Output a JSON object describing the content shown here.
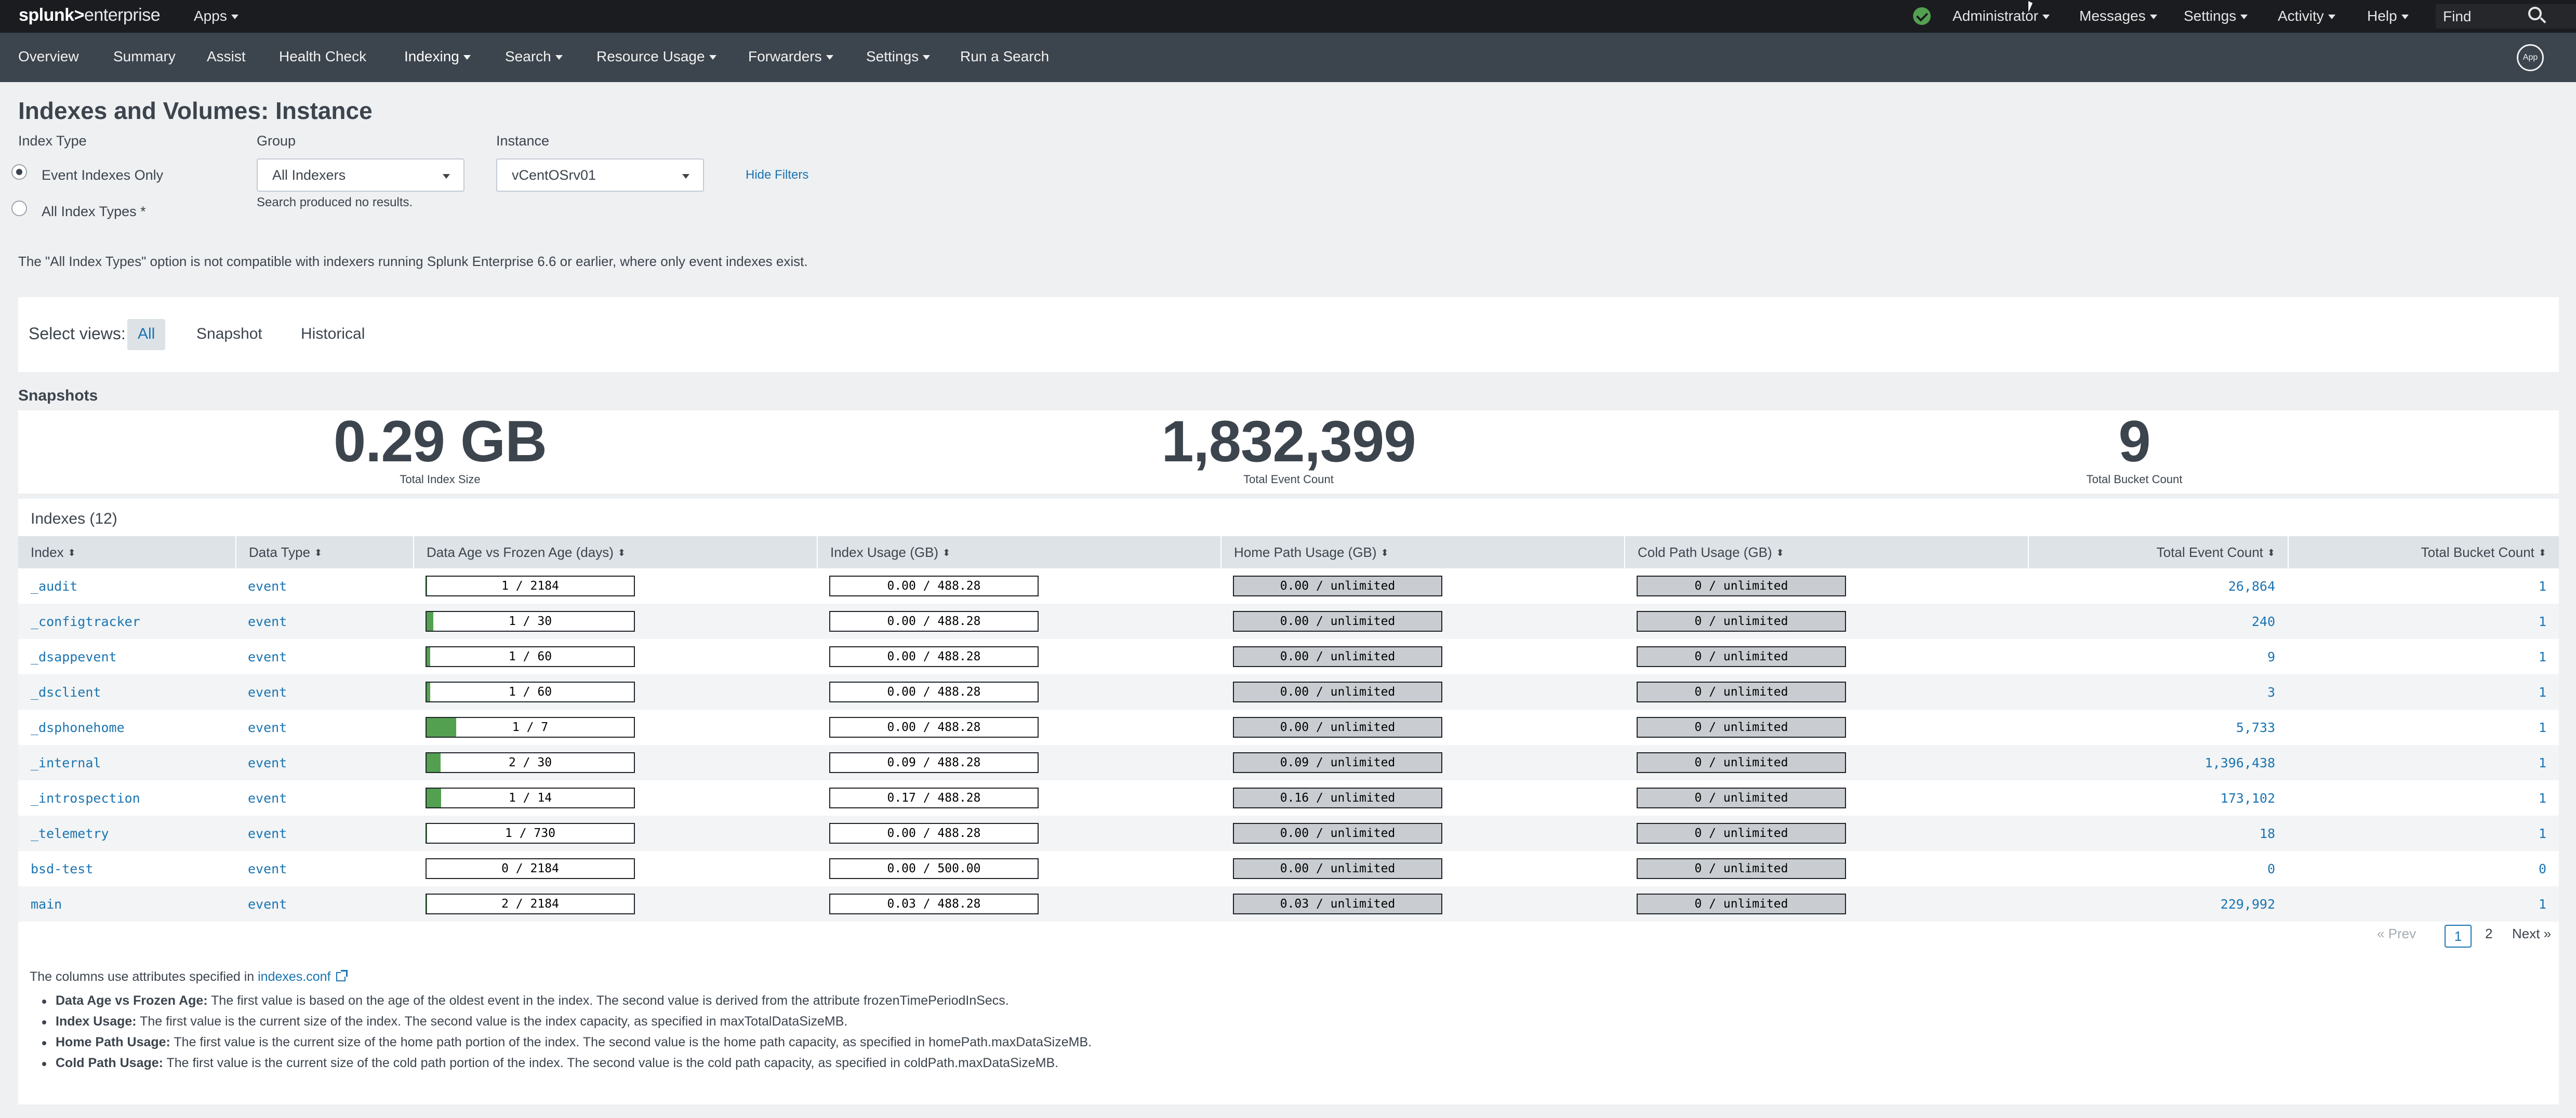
{
  "topbar": {
    "logo_bold": "splunk>",
    "logo_light": "enterprise",
    "apps": "Apps",
    "user": "Administrator",
    "messages": "Messages",
    "settings": "Settings",
    "activity": "Activity",
    "help": "Help",
    "find_placeholder": "Find",
    "status_color": "#53a051"
  },
  "nav": {
    "items": [
      "Overview",
      "Summary",
      "Assist",
      "Health Check",
      "Indexing",
      "Search",
      "Resource Usage",
      "Forwarders",
      "Settings",
      "Run a Search"
    ],
    "active": "Indexing",
    "app_badge": "App"
  },
  "page": {
    "title": "Indexes and Volumes: Instance"
  },
  "filters": {
    "index_type_label": "Index Type",
    "option_event": "Event Indexes Only",
    "option_all": "All Index Types *",
    "selected": "Event Indexes Only",
    "group_label": "Group",
    "group_value": "All Indexers",
    "group_message": "Search produced no results.",
    "instance_label": "Instance",
    "instance_value": "vCentOSrv01",
    "hide_filters": "Hide Filters",
    "note": "The \"All Index Types\" option is not compatible with indexers running Splunk Enterprise 6.6 or earlier, where only event indexes exist."
  },
  "views": {
    "label": "Select views:",
    "options": [
      "All",
      "Snapshot",
      "Historical"
    ],
    "active": "All"
  },
  "snapshots": {
    "title": "Snapshots",
    "total_index_size": "0.29 GB",
    "total_index_size_label": "Total Index Size",
    "total_event_count": "1,832,399",
    "total_event_count_label": "Total Event Count",
    "total_bucket_count": "9",
    "total_bucket_count_label": "Total Bucket Count"
  },
  "indexes": {
    "title": "Indexes (12)",
    "columns": [
      "Index",
      "Data Type",
      "Data Age vs Frozen Age (days)",
      "Index Usage (GB)",
      "Home Path Usage (GB)",
      "Cold Path Usage (GB)",
      "Total Event Count",
      "Total Bucket Count"
    ],
    "rows": [
      {
        "index": "_audit",
        "type": "event",
        "age": "1 / 2184",
        "age_pct": 0.05,
        "usage": "0.00 / 488.28",
        "usage_pct": 0,
        "home": "0.00 / unlimited",
        "cold": "0 / unlimited",
        "events": "26,864",
        "buckets": "1"
      },
      {
        "index": "_configtracker",
        "type": "event",
        "age": "1 / 30",
        "age_pct": 3.3,
        "usage": "0.00 / 488.28",
        "usage_pct": 0,
        "home": "0.00 / unlimited",
        "cold": "0 / unlimited",
        "events": "240",
        "buckets": "1"
      },
      {
        "index": "_dsappevent",
        "type": "event",
        "age": "1 / 60",
        "age_pct": 1.7,
        "usage": "0.00 / 488.28",
        "usage_pct": 0,
        "home": "0.00 / unlimited",
        "cold": "0 / unlimited",
        "events": "9",
        "buckets": "1"
      },
      {
        "index": "_dsclient",
        "type": "event",
        "age": "1 / 60",
        "age_pct": 1.7,
        "usage": "0.00 / 488.28",
        "usage_pct": 0,
        "home": "0.00 / unlimited",
        "cold": "0 / unlimited",
        "events": "3",
        "buckets": "1"
      },
      {
        "index": "_dsphonehome",
        "type": "event",
        "age": "1 / 7",
        "age_pct": 14.3,
        "usage": "0.00 / 488.28",
        "usage_pct": 0,
        "home": "0.00 / unlimited",
        "cold": "0 / unlimited",
        "events": "5,733",
        "buckets": "1"
      },
      {
        "index": "_internal",
        "type": "event",
        "age": "2 / 30",
        "age_pct": 6.7,
        "usage": "0.09 / 488.28",
        "usage_pct": 0,
        "home": "0.09 / unlimited",
        "cold": "0 / unlimited",
        "events": "1,396,438",
        "buckets": "1"
      },
      {
        "index": "_introspection",
        "type": "event",
        "age": "1 / 14",
        "age_pct": 7.1,
        "usage": "0.17 / 488.28",
        "usage_pct": 0,
        "home": "0.16 / unlimited",
        "cold": "0 / unlimited",
        "events": "173,102",
        "buckets": "1"
      },
      {
        "index": "_telemetry",
        "type": "event",
        "age": "1 / 730",
        "age_pct": 0.1,
        "usage": "0.00 / 488.28",
        "usage_pct": 0,
        "home": "0.00 / unlimited",
        "cold": "0 / unlimited",
        "events": "18",
        "buckets": "1"
      },
      {
        "index": "bsd-test",
        "type": "event",
        "age": "0 / 2184",
        "age_pct": 0,
        "usage": "0.00 / 500.00",
        "usage_pct": 0,
        "home": "0.00 / unlimited",
        "cold": "0 / unlimited",
        "events": "0",
        "buckets": "0"
      },
      {
        "index": "main",
        "type": "event",
        "age": "2 / 2184",
        "age_pct": 0.1,
        "usage": "0.03 / 488.28",
        "usage_pct": 0,
        "home": "0.03 / unlimited",
        "cold": "0 / unlimited",
        "events": "229,992",
        "buckets": "1"
      }
    ],
    "bar_fill_color": "#53a051",
    "pagination": {
      "prev": "« Prev",
      "pages": [
        "1",
        "2"
      ],
      "current": "1",
      "next": "Next »"
    }
  },
  "footnotes": {
    "intro": "The columns use attributes specified in",
    "intro_link": "indexes.conf",
    "items": [
      {
        "term": "Data Age vs Frozen Age:",
        "text": "The first value is based on the age of the oldest event in the index. The second value is derived from the attribute frozenTimePeriodInSecs."
      },
      {
        "term": "Index Usage:",
        "text": "The first value is the current size of the index. The second value is the index capacity, as specified in maxTotalDataSizeMB."
      },
      {
        "term": "Home Path Usage:",
        "text": "The first value is the current size of the home path portion of the index. The second value is the home path capacity, as specified in homePath.maxDataSizeMB."
      },
      {
        "term": "Cold Path Usage:",
        "text": "The first value is the current size of the cold path portion of the index. The second value is the cold path capacity, as specified in coldPath.maxDataSizeMB."
      }
    ]
  }
}
